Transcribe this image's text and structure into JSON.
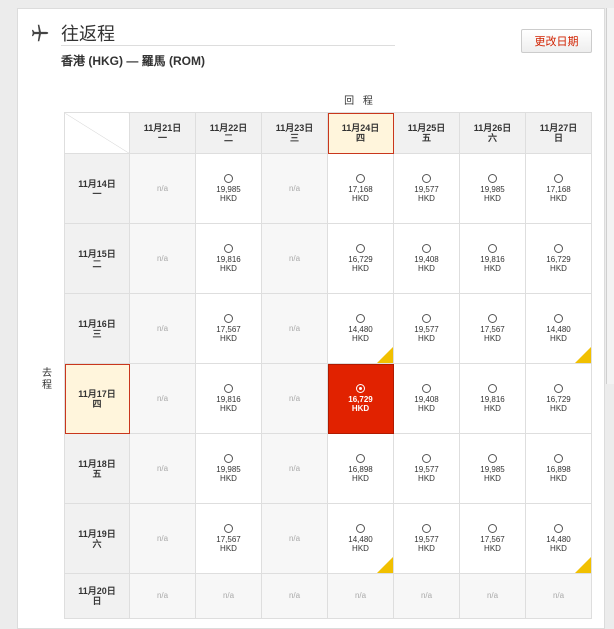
{
  "title": "往返程",
  "route": "香港 (HKG) — 羅馬 (ROM)",
  "change_button": "更改日期",
  "return_label": "回 程",
  "outbound_label": "去程",
  "na_text": "n/a",
  "currency": "HKD",
  "colors": {
    "accent": "#e12200",
    "flag": "#f1c000",
    "selected_header": "#fff5dc"
  },
  "icons": {
    "plane": "plane-icon"
  },
  "return_dates": [
    {
      "date": "11月21日",
      "weekday": "一"
    },
    {
      "date": "11月22日",
      "weekday": "二"
    },
    {
      "date": "11月23日",
      "weekday": "三"
    },
    {
      "date": "11月24日",
      "weekday": "四",
      "selected": true
    },
    {
      "date": "11月25日",
      "weekday": "五"
    },
    {
      "date": "11月26日",
      "weekday": "六"
    },
    {
      "date": "11月27日",
      "weekday": "日"
    }
  ],
  "outbound_dates": [
    {
      "date": "11月14日",
      "weekday": "一"
    },
    {
      "date": "11月15日",
      "weekday": "二"
    },
    {
      "date": "11月16日",
      "weekday": "三"
    },
    {
      "date": "11月17日",
      "weekday": "四",
      "selected": true
    },
    {
      "date": "11月18日",
      "weekday": "五"
    },
    {
      "date": "11月19日",
      "weekday": "六"
    },
    {
      "date": "11月20日",
      "weekday": "日"
    }
  ],
  "prices": [
    [
      null,
      "19,985",
      null,
      "17,168",
      "19,577",
      "19,985",
      "17,168"
    ],
    [
      null,
      "19,816",
      null,
      "16,729",
      "19,408",
      "19,816",
      "16,729"
    ],
    [
      null,
      "17,567",
      null,
      "14,480",
      "19,577",
      "17,567",
      "14,480"
    ],
    [
      null,
      "19,816",
      null,
      "16,729",
      "19,408",
      "19,816",
      "16,729"
    ],
    [
      null,
      "19,985",
      null,
      "16,898",
      "19,577",
      "19,985",
      "16,898"
    ],
    [
      null,
      "17,567",
      null,
      "14,480",
      "19,577",
      "17,567",
      "14,480"
    ],
    [
      null,
      null,
      null,
      null,
      null,
      null,
      null
    ]
  ],
  "flagged": [
    [
      2,
      3
    ],
    [
      2,
      6
    ],
    [
      5,
      3
    ],
    [
      5,
      6
    ]
  ],
  "selected_cell": [
    3,
    3
  ]
}
